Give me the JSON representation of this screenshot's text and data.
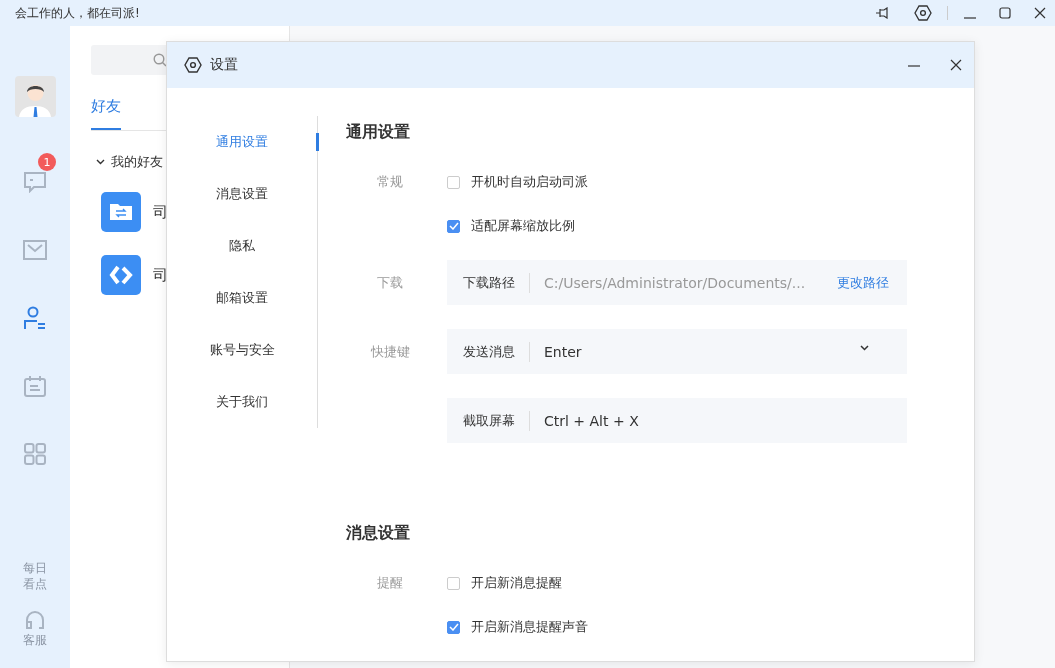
{
  "app_title": "会工作的人，都在司派!",
  "rail_items": [
    {
      "kind": "chat",
      "selected": false,
      "badge": "1"
    },
    {
      "kind": "mail",
      "selected": false
    },
    {
      "kind": "contacts",
      "selected": true
    },
    {
      "kind": "calendar",
      "selected": false
    },
    {
      "kind": "apps",
      "selected": false
    }
  ],
  "rail_bottom": [
    {
      "kind": "text",
      "label": "每日看点"
    },
    {
      "kind": "headset",
      "label": "客服"
    }
  ],
  "contacts": {
    "tabs": [
      {
        "label": "好友",
        "selected": true
      }
    ],
    "group": {
      "label": "我的好友",
      "expanded": true
    },
    "items": [
      {
        "kind": "folder",
        "name": "司"
      },
      {
        "kind": "logo",
        "name": "司"
      }
    ]
  },
  "dialog": {
    "title": "设置",
    "nav": [
      {
        "label": "通用设置",
        "selected": true
      },
      {
        "label": "消息设置",
        "selected": false
      },
      {
        "label": "隐私",
        "selected": false
      },
      {
        "label": "邮箱设置",
        "selected": false
      },
      {
        "label": "账号与安全",
        "selected": false
      },
      {
        "label": "关于我们",
        "selected": false
      }
    ],
    "sections": [
      {
        "heading": "通用设置",
        "rows": [
          {
            "kind": "checkbox",
            "label": "常规",
            "text": "开机时自动启动司派",
            "checked": false
          },
          {
            "kind": "checkbox",
            "text": "适配屏幕缩放比例",
            "checked": true
          },
          {
            "kind": "path",
            "label": "下载",
            "name": "下载路径",
            "value": "C:/Users/Administrator/Documents/...",
            "action": "更改路径"
          },
          {
            "kind": "select",
            "label": "快捷键",
            "name": "发送消息",
            "value": "Enter"
          },
          {
            "kind": "shortcut",
            "name": "截取屏幕",
            "value": "Ctrl + Alt + X"
          }
        ]
      },
      {
        "heading": "消息设置",
        "rows": [
          {
            "kind": "checkbox",
            "label": "提醒",
            "text": "开启新消息提醒",
            "checked": false
          },
          {
            "kind": "checkbox",
            "text": "开启新消息提醒声音",
            "checked": true
          }
        ]
      }
    ]
  }
}
